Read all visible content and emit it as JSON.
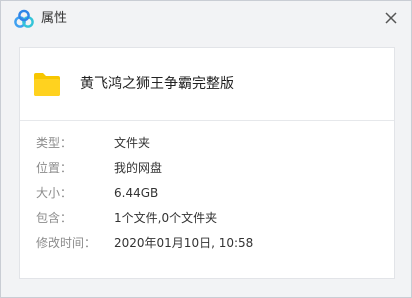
{
  "window": {
    "title": "属性",
    "app_icon": "baidu-netdisk-logo-icon",
    "close_icon": "close-icon",
    "accent_color": "#3a8ee6"
  },
  "file": {
    "icon": "folder-icon",
    "icon_color": "#f7c600",
    "name": "黄飞鸿之狮王争霸完整版"
  },
  "properties": {
    "type": {
      "label": "类型：",
      "value": "文件夹"
    },
    "location": {
      "label": "位置：",
      "value": "我的网盘"
    },
    "size": {
      "label": "大小：",
      "value": "6.44GB"
    },
    "contains": {
      "label": "包含：",
      "value": "1个文件,0个文件夹"
    },
    "modified": {
      "label": "修改时间：",
      "value": "2020年01月10日, 10:58"
    }
  }
}
